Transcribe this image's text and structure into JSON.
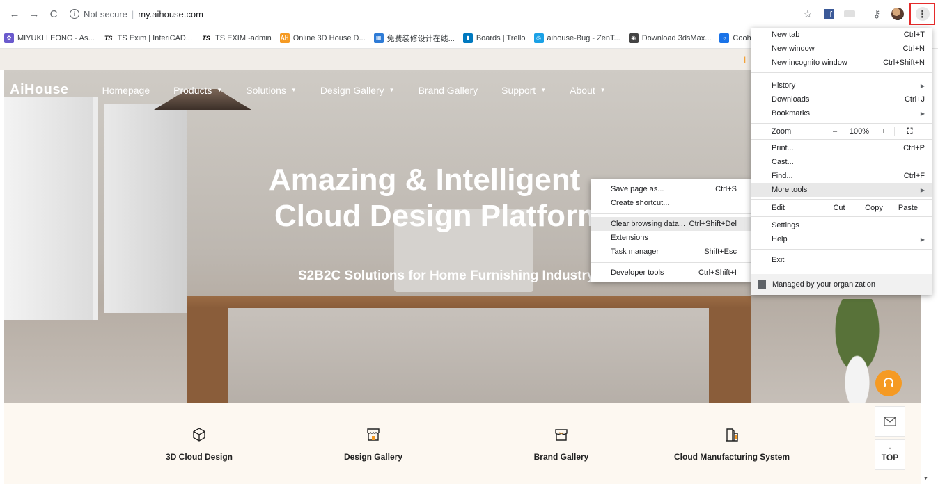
{
  "browser": {
    "nav": {
      "back": "←",
      "forward": "→",
      "reload": "C"
    },
    "omnibox": {
      "security": "Not secure",
      "url": "my.aihouse.com"
    }
  },
  "bookmarks": [
    {
      "label": "MIYUKI LEONG - As...",
      "icon_bg": "#6a5acd",
      "icon_text": "✿"
    },
    {
      "label": "TS Exim | InteriCAD...",
      "icon_bg": "",
      "icon_text": "TS"
    },
    {
      "label": "TS EXIM -admin",
      "icon_bg": "",
      "icon_text": "TS"
    },
    {
      "label": "Online 3D House D...",
      "icon_bg": "#f59a23",
      "icon_text": "AH"
    },
    {
      "label": "免费装修设计在线...",
      "icon_bg": "#2e7bd6",
      "icon_text": "▦"
    },
    {
      "label": "Boards | Trello",
      "icon_bg": "#0079bf",
      "icon_text": "▮"
    },
    {
      "label": "aihouse-Bug - ZenT...",
      "icon_bg": "#1aa1e6",
      "icon_text": "◎"
    },
    {
      "label": "Download 3dsMax...",
      "icon_bg": "#444",
      "icon_text": "◉"
    },
    {
      "label": "Cooho",
      "icon_bg": "#1a73e8",
      "icon_text": "○"
    }
  ],
  "site": {
    "logo": "AiHouse",
    "nav": [
      {
        "label": "Homepage",
        "dropdown": false
      },
      {
        "label": "Products",
        "dropdown": true
      },
      {
        "label": "Solutions",
        "dropdown": true
      },
      {
        "label": "Design Gallery",
        "dropdown": true
      },
      {
        "label": "Brand Gallery",
        "dropdown": false
      },
      {
        "label": "Support",
        "dropdown": true
      },
      {
        "label": "About",
        "dropdown": true
      }
    ],
    "hero_title_line1": "Amazing & Intellig",
    "hero_title_line1_tail": "ent",
    "hero_title_line2": "Cloud Design Platf",
    "hero_title_line2_tail": "orm",
    "hero_subtitle": "S2B2C Solutions for Home Furnishing Indu",
    "hero_subtitle_tail": "stry",
    "strip_text": "I'",
    "features": [
      {
        "label": "3D Cloud Design",
        "icon": "cube-icon"
      },
      {
        "label": "Design Gallery",
        "icon": "store-icon"
      },
      {
        "label": "Brand Gallery",
        "icon": "shop-icon"
      },
      {
        "label": "Cloud Manufacturing System",
        "icon": "building-icon"
      }
    ],
    "side": {
      "top_label": "TOP",
      "top_arrow": "^"
    }
  },
  "chrome_menu": {
    "items": {
      "new_tab": {
        "label": "New tab",
        "shortcut": "Ctrl+T"
      },
      "new_window": {
        "label": "New window",
        "shortcut": "Ctrl+N"
      },
      "incognito": {
        "label": "New incognito window",
        "shortcut": "Ctrl+Shift+N"
      },
      "history": {
        "label": "History"
      },
      "downloads": {
        "label": "Downloads",
        "shortcut": "Ctrl+J"
      },
      "bookmarks": {
        "label": "Bookmarks"
      },
      "zoom": {
        "label": "Zoom",
        "minus": "–",
        "value": "100%",
        "plus": "+"
      },
      "print": {
        "label": "Print...",
        "shortcut": "Ctrl+P"
      },
      "cast": {
        "label": "Cast..."
      },
      "find": {
        "label": "Find...",
        "shortcut": "Ctrl+F"
      },
      "more_tools": {
        "label": "More tools"
      },
      "edit": {
        "label": "Edit",
        "cut": "Cut",
        "copy": "Copy",
        "paste": "Paste"
      },
      "settings": {
        "label": "Settings"
      },
      "help": {
        "label": "Help"
      },
      "exit": {
        "label": "Exit"
      }
    },
    "managed": "Managed by your organization"
  },
  "more_tools_menu": [
    {
      "label": "Save page as...",
      "shortcut": "Ctrl+S"
    },
    {
      "label": "Create shortcut...",
      "shortcut": ""
    },
    {
      "label": "Clear browsing data...",
      "shortcut": "Ctrl+Shift+Del"
    },
    {
      "label": "Extensions",
      "shortcut": ""
    },
    {
      "label": "Task manager",
      "shortcut": "Shift+Esc"
    },
    {
      "label": "Developer tools",
      "shortcut": "Ctrl+Shift+I"
    }
  ],
  "colors": {
    "accent_orange": "#f59a23",
    "highlight_red": "#e52b2b",
    "menu_hover": "#e8e8e8"
  }
}
